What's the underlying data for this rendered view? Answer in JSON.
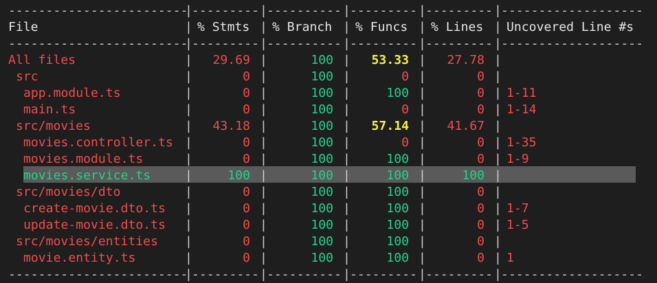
{
  "separator": {
    "file": "------------------------",
    "stmts": "---------",
    "branch": "----------",
    "funcs": "---------",
    "lines": "---------",
    "uncovered": "-------------------",
    "pipe": "|"
  },
  "header": {
    "file": "File",
    "stmts": "% Stmts",
    "branch": "% Branch",
    "funcs": "% Funcs",
    "lines": "% Lines",
    "uncovered": "Uncovered Line #s"
  },
  "rows": [
    {
      "file": "All files",
      "stmts": "29.69",
      "branch": "100",
      "funcs": "53.33",
      "lines": "27.78",
      "uncovered": "",
      "indent": 0
    },
    {
      "file": "src",
      "stmts": "0",
      "branch": "100",
      "funcs": "0",
      "lines": "0",
      "uncovered": "",
      "indent": 1
    },
    {
      "file": "app.module.ts",
      "stmts": "0",
      "branch": "100",
      "funcs": "100",
      "lines": "0",
      "uncovered": "1-11",
      "indent": 2
    },
    {
      "file": "main.ts",
      "stmts": "0",
      "branch": "100",
      "funcs": "0",
      "lines": "0",
      "uncovered": "1-14",
      "indent": 2
    },
    {
      "file": "src/movies",
      "stmts": "43.18",
      "branch": "100",
      "funcs": "57.14",
      "lines": "41.67",
      "uncovered": "",
      "indent": 1
    },
    {
      "file": "movies.controller.ts",
      "stmts": "0",
      "branch": "100",
      "funcs": "0",
      "lines": "0",
      "uncovered": "1-35",
      "indent": 2
    },
    {
      "file": "movies.module.ts",
      "stmts": "0",
      "branch": "100",
      "funcs": "100",
      "lines": "0",
      "uncovered": "1-9",
      "indent": 2
    },
    {
      "file": "movies.service.ts",
      "stmts": "100",
      "branch": "100",
      "funcs": "100",
      "lines": "100",
      "uncovered": "",
      "indent": 2
    },
    {
      "file": "src/movies/dto",
      "stmts": "0",
      "branch": "100",
      "funcs": "100",
      "lines": "0",
      "uncovered": "",
      "indent": 1
    },
    {
      "file": "create-movie.dto.ts",
      "stmts": "0",
      "branch": "100",
      "funcs": "100",
      "lines": "0",
      "uncovered": "1-7",
      "indent": 2
    },
    {
      "file": "update-movie.dto.ts",
      "stmts": "0",
      "branch": "100",
      "funcs": "100",
      "lines": "0",
      "uncovered": "1-5",
      "indent": 2
    },
    {
      "file": "src/movies/entities",
      "stmts": "0",
      "branch": "100",
      "funcs": "100",
      "lines": "0",
      "uncovered": "",
      "indent": 1
    },
    {
      "file": "movie.entity.ts",
      "stmts": "0",
      "branch": "100",
      "funcs": "100",
      "lines": "0",
      "uncovered": "1",
      "indent": 2
    }
  ],
  "colors": {
    "background": "#1e1e1e",
    "low": "#f14c4c",
    "medium": "#f5f543",
    "high": "#23d18b",
    "text": "#cccccc",
    "selection": "#5a5a5a"
  }
}
